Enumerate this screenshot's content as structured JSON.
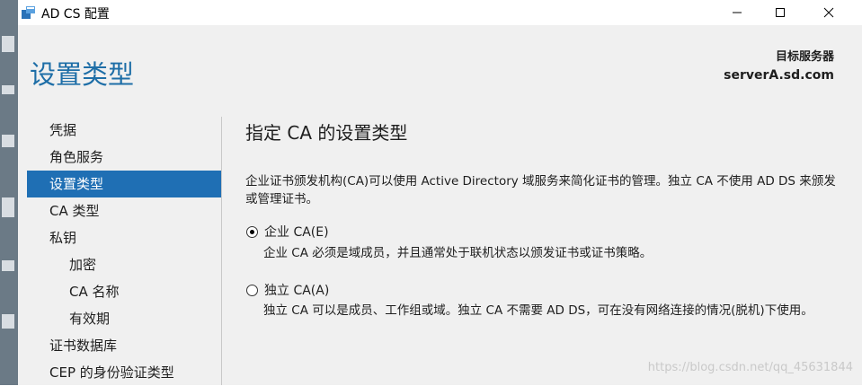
{
  "window": {
    "title": "AD CS 配置",
    "controls": [
      "minimize",
      "maximize",
      "close"
    ]
  },
  "header": {
    "title": "设置类型",
    "target_label": "目标服务器",
    "target_value": "serverA.sd.com"
  },
  "nav": {
    "items": [
      {
        "label": "凭据",
        "level": 0,
        "active": false
      },
      {
        "label": "角色服务",
        "level": 0,
        "active": false
      },
      {
        "label": "设置类型",
        "level": 0,
        "active": true
      },
      {
        "label": "CA 类型",
        "level": 0,
        "active": false
      },
      {
        "label": "私钥",
        "level": 0,
        "active": false
      },
      {
        "label": "加密",
        "level": 1,
        "active": false
      },
      {
        "label": "CA 名称",
        "level": 1,
        "active": false
      },
      {
        "label": "有效期",
        "level": 1,
        "active": false
      },
      {
        "label": "证书数据库",
        "level": 0,
        "active": false
      },
      {
        "label": "CEP 的身份验证类型",
        "level": 0,
        "active": false
      }
    ]
  },
  "content": {
    "title": "指定 CA 的设置类型",
    "description": "企业证书颁发机构(CA)可以使用 Active Directory 域服务来简化证书的管理。独立 CA 不使用 AD DS 来颁发或管理证书。",
    "options": [
      {
        "label": "企业 CA(E)",
        "selected": true,
        "description": "企业 CA 必须是域成员，并且通常处于联机状态以颁发证书或证书策略。"
      },
      {
        "label": "独立 CA(A)",
        "selected": false,
        "description": "独立 CA 可以是成员、工作组或域。独立 CA 不需要 AD DS，可在没有网络连接的情况(脱机)下使用。"
      }
    ]
  },
  "watermark": "https://blog.csdn.net/qq_45631844",
  "colors": {
    "accent": "#1f6fb4",
    "header_title": "#1e6ea7",
    "background": "#f0f0f0"
  }
}
